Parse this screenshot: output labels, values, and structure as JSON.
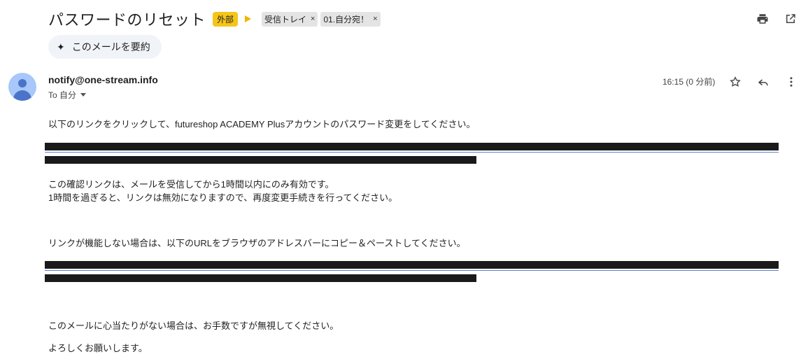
{
  "email": {
    "subject": "パスワードのリセット",
    "external_badge": "外部",
    "labels": [
      {
        "text": "受信トレイ",
        "remove": "×"
      },
      {
        "text": "01.自分宛！",
        "remove": "×"
      }
    ],
    "summarize_label": "このメールを要約",
    "sender": "notify@one-stream.info",
    "to_label": "To 自分",
    "time": "16:15 (0 分前)",
    "paragraphs": {
      "p1": "以下のリンクをクリックして、futureshop ACADEMY Plusアカウントのパスワード変更をしてください。",
      "p2a": "この確認リンクは、メールを受信してから1時間以内にのみ有効です。",
      "p2b": "1時間を過ぎると、リンクは無効になりますので、再度変更手続きを行ってください。",
      "p3": "リンクが機能しない場合は、以下のURLをブラウザのアドレスバーにコピー＆ペーストしてください。",
      "p4": "このメールに心当たりがない場合は、お手数ですが無視してください。",
      "p5": "よろしくお願いします。"
    }
  },
  "icons": {
    "print": "print-icon",
    "open_new": "open-in-new-window-icon",
    "star": "star-icon",
    "reply": "reply-icon",
    "more": "more-vert-icon",
    "spark": "sparkle-icon"
  },
  "colors": {
    "external_badge": "#f5c518",
    "important_marker": "#f4b400",
    "avatar_bg": "#a8c7fa",
    "avatar_fg": "#4a74c9",
    "summarize_bg": "#f0f4f9",
    "redaction": "#1a1a1a",
    "link": "#5b7fd6"
  }
}
